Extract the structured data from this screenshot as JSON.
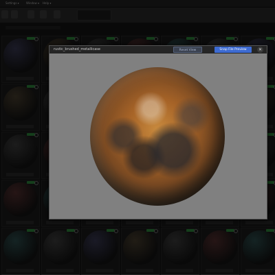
{
  "topbar": {
    "menus": [
      {
        "label": "Settings ▾"
      },
      {
        "label": "Window ▾"
      },
      {
        "label": "Help ▾"
      }
    ]
  },
  "modal": {
    "title": "rustic_brushed_metallicase",
    "reset_view_label": "Reset View",
    "snap_label": "Snap File Preview",
    "close_label": "✕"
  },
  "colors": {
    "accent_blue": "#3d6bd2",
    "badge_green": "#2f8a3c",
    "preview_bg": "#808080"
  }
}
